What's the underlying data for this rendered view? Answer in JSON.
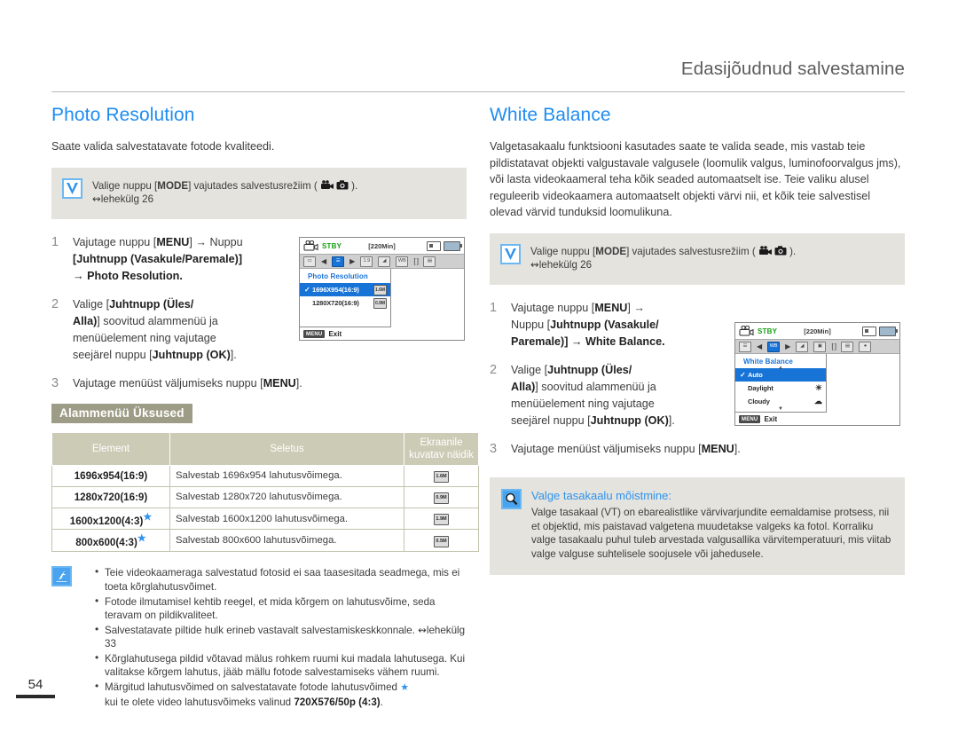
{
  "header": {
    "title": "Edasijõudnud salvestamine"
  },
  "page_number": "54",
  "left": {
    "section_title": "Photo Resolution",
    "intro": "Saate valida salvestatavate fotode kvaliteedi.",
    "infobox": {
      "icon": "check-icon",
      "line1_pre": "Valige nuppu [",
      "line1_bold": "MODE",
      "line1_mid": "] vajutades salvestusrežiim ( ",
      "line1_icons": "video-camera-icon photo-camera-icon",
      "line1_post": " ).",
      "line2": "↭lehekülg 26"
    },
    "steps": [
      {
        "num": "1",
        "l1_pre": "Vajutage nuppu [",
        "l1_b": "MENU",
        "l1_post": "] → Nuppu",
        "l2": "[Juhtnupp (Vasakule/Paremale)]",
        "l3": "→ Photo Resolution."
      },
      {
        "num": "2",
        "l1_pre": "Valige [",
        "l1_b": "Juhtnupp (Üles/",
        "l2_b": "Alla)",
        "l2_post": "] soovitud alammenüü ja",
        "l3": "menüüelement ning vajutage",
        "l4_pre": "seejärel nuppu [",
        "l4_b": "Juhtnupp (OK)",
        "l4_post": "]."
      },
      {
        "num": "3",
        "l1_pre": "Vajutage menüüst väljumiseks nuppu [",
        "l1_b": "MENU",
        "l1_post": "]."
      }
    ],
    "lcd": {
      "status": "STBY",
      "time": "[220Min]",
      "menu_title": "Photo Resolution",
      "rows": [
        {
          "check": "✓",
          "label": "1696X954(16:9)",
          "indicator": "1.6M",
          "selected": true
        },
        {
          "check": "",
          "label": "1280X720(16:9)",
          "indicator": "0.9M",
          "selected": false
        }
      ],
      "menu_button": "MENU",
      "exit_label": "Exit"
    },
    "submenu_badge": "Alammenüü Üksused",
    "table": {
      "headers": [
        "Element",
        "Seletus",
        "Ekraanile kuvatav näidik"
      ],
      "rows": [
        {
          "element": "1696x954(16:9)",
          "star": false,
          "desc": "Salvestab 1696x954 lahutusvõimega.",
          "indicator": "1.6M"
        },
        {
          "element": "1280x720(16:9)",
          "star": false,
          "desc": "Salvestab 1280x720 lahutusvõimega.",
          "indicator": "0.9M"
        },
        {
          "element": "1600x1200(4:3)",
          "star": true,
          "desc": "Salvestab 1600x1200 lahutusvõimega.",
          "indicator": "1.9M"
        },
        {
          "element": "800x600(4:3)",
          "star": true,
          "desc": "Salvestab 800x600 lahutusvõimega.",
          "indicator": "0.5M"
        }
      ]
    },
    "notes": {
      "icon": "note-pen-icon",
      "items": [
        "Teie videokaameraga salvestatud fotosid ei saa taasesitada seadmega, mis ei toeta kõrglahutusvõimet.",
        "Fotode ilmutamisel kehtib reegel, et mida kõrgem on lahutusvõime, seda teravam on pildikvaliteet.",
        "Salvestatavate piltide hulk erineb vastavalt salvestamiskeskkonnale. ↭lehekülg 33",
        "Kõrglahutusega pildid võtavad mälus rohkem ruumi kui madala lahutusega. Kui valitakse kõrgem lahutus, jääb mällu fotode salvestamiseks vähem ruumi.",
        "Märgitud lahutusvõimed on salvestatavate fotode lahutusvõimed ★ kui te olete video lahutusvõimeks valinud 720X576/50p (4:3)."
      ],
      "last_item_pre": "Märgitud lahutusvõimed on salvestatavate fotode lahutusvõimed ",
      "last_item_star": "★",
      "last_item_mid": "kui te olete video lahutusvõimeks valinud ",
      "last_item_bold": "720X576/50p (4:3)",
      "last_item_post": "."
    }
  },
  "right": {
    "section_title": "White Balance",
    "intro": "Valgetasakaalu funktsiooni kasutades saate te valida seade, mis vastab teie pildistatavat objekti valgustavale valgusele (loomulik valgus, luminofoorvalgus jms), või lasta videokaameral teha kõik seaded automaatselt ise. Teie valiku alusel reguleerib videokaamera automaatselt objekti värvi nii, et kõik teie salvestisel olevad värvid tunduksid loomulikuna.",
    "infobox": {
      "icon": "check-icon",
      "line1_pre": "Valige nuppu [",
      "line1_bold": "MODE",
      "line1_mid": "] vajutades salvestusrežiim ( ",
      "line1_post": " ).",
      "line2": "↭lehekülg 26"
    },
    "steps": [
      {
        "num": "1",
        "l1_pre": "Vajutage nuppu [",
        "l1_b": "MENU",
        "l1_post": "] →",
        "l2_pre": "Nuppu [",
        "l2_b": "Juhtnupp (Vasakule/",
        "l3_b": "Paremale)",
        "l3_post": "] → White Balance."
      },
      {
        "num": "2",
        "l1_pre": "Valige [",
        "l1_b": "Juhtnupp (Üles/",
        "l2_b": "Alla)",
        "l2_post": "] soovitud alammenüü ja",
        "l3": "menüüelement ning vajutage",
        "l4_pre": "seejärel nuppu [",
        "l4_b": "Juhtnupp (OK)",
        "l4_post": "]."
      },
      {
        "num": "3",
        "l1_pre": "Vajutage menüüst väljumiseks nuppu [",
        "l1_b": "MENU",
        "l1_post": "]."
      }
    ],
    "lcd": {
      "status": "STBY",
      "time": "[220Min]",
      "menu_title": "White Balance",
      "rows": [
        {
          "check": "✓",
          "label": "Auto",
          "glyph": "",
          "selected": true
        },
        {
          "check": "",
          "label": "Daylight",
          "glyph": "☀",
          "selected": false
        },
        {
          "check": "",
          "label": "Cloudy",
          "glyph": "☁",
          "selected": false
        }
      ],
      "menu_button": "MENU",
      "exit_label": "Exit"
    },
    "understanding": {
      "icon": "magnifier-icon",
      "title": "Valge tasakaalu mõistmine:",
      "text": "Valge tasakaal (VT) on ebarealistlike värvivarjundite eemaldamise protsess, nii et objektid, mis paistavad valgetena muudetakse valgeks ka fotol. Korraliku valge tasakaalu puhul tuleb arvestada valgusallika värvitemperatuuri, mis viitab valge valguse suhtelisele soojusele või jahedusele."
    }
  },
  "colors": {
    "heading_blue": "#1f8cf0",
    "info_bg": "#e4e3dd",
    "badge_bg": "#9d9d87",
    "table_header_bg": "#cbcbb6",
    "lcd_select_blue": "#1773d6",
    "stby_green": "#12a012"
  }
}
